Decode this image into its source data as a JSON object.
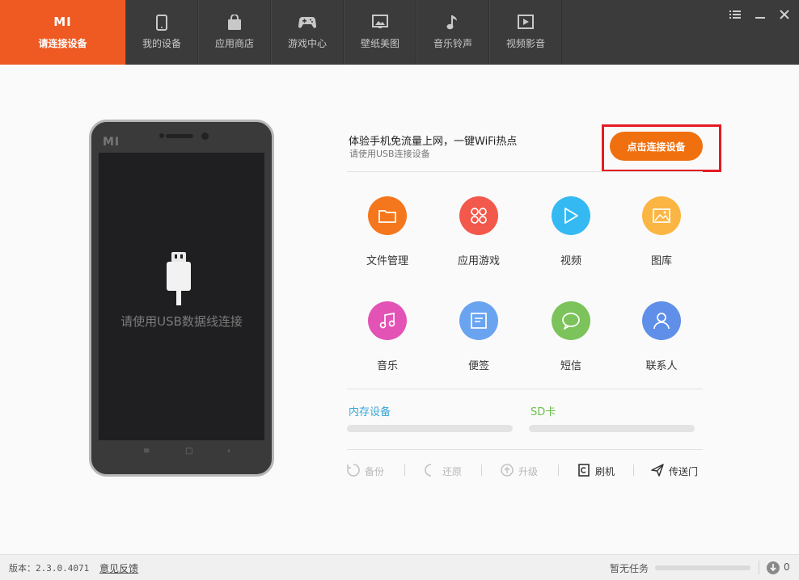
{
  "topbar": {
    "tabs": [
      {
        "label": "请连接设备",
        "icon": "mi-logo-icon"
      },
      {
        "label": "我的设备",
        "icon": "phone-icon"
      },
      {
        "label": "应用商店",
        "icon": "shopping-bag-icon"
      },
      {
        "label": "游戏中心",
        "icon": "gamepad-icon"
      },
      {
        "label": "壁纸美图",
        "icon": "picture-icon"
      },
      {
        "label": "音乐铃声",
        "icon": "music-note-icon"
      },
      {
        "label": "视频影音",
        "icon": "video-play-icon"
      }
    ],
    "logo_text": "MI"
  },
  "phone": {
    "brand": "MI",
    "screen_text": "请使用USB数据线连接",
    "softkeys": [
      "≡",
      "□",
      "‹"
    ]
  },
  "promo": {
    "title": "体验手机免流量上网，一键WiFi热点",
    "subtitle": "请使用USB连接设备",
    "connect_button": "点击连接设备"
  },
  "functions": [
    {
      "label": "文件管理",
      "icon": "folder-icon",
      "color": "#f5771d"
    },
    {
      "label": "应用游戏",
      "icon": "apps-icon",
      "color": "#f2584b"
    },
    {
      "label": "视频",
      "icon": "play-icon",
      "color": "#35b9f2"
    },
    {
      "label": "图库",
      "icon": "gallery-icon",
      "color": "#fbb542"
    },
    {
      "label": "音乐",
      "icon": "music-icon",
      "color": "#e353b5"
    },
    {
      "label": "便签",
      "icon": "note-icon",
      "color": "#6aa4f0"
    },
    {
      "label": "短信",
      "icon": "message-icon",
      "color": "#7bc35a"
    },
    {
      "label": "联系人",
      "icon": "contact-icon",
      "color": "#5f8fe8"
    }
  ],
  "storage": {
    "internal_label": "内存设备",
    "internal_color": "#35a6d8",
    "sd_label": "SD卡",
    "sd_color": "#6cbf4a"
  },
  "actions": [
    {
      "label": "备份",
      "icon": "backup-icon",
      "enabled": false
    },
    {
      "label": "还原",
      "icon": "restore-icon",
      "enabled": false
    },
    {
      "label": "升级",
      "icon": "upgrade-icon",
      "enabled": false
    },
    {
      "label": "刷机",
      "icon": "flash-icon",
      "enabled": true
    },
    {
      "label": "传送门",
      "icon": "send-icon",
      "enabled": true
    }
  ],
  "statusbar": {
    "version": "版本：2.3.0.4071",
    "feedback": "意见反馈",
    "task_status": "暂无任务",
    "download_count": "0"
  }
}
